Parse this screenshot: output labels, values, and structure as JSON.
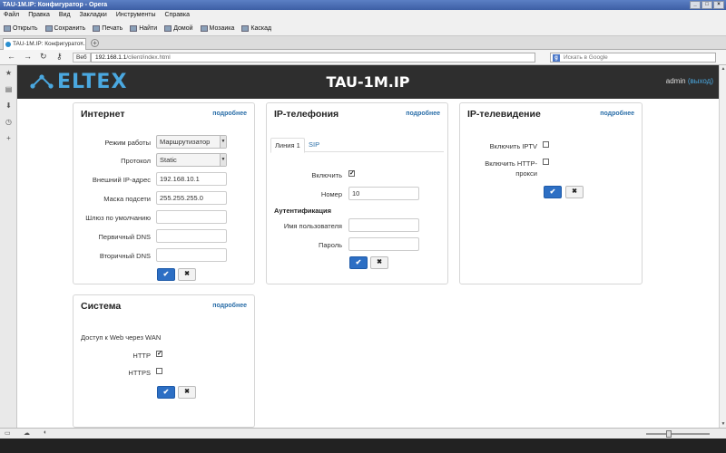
{
  "window": {
    "title": "TAU-1M.IP: Конфигуратор - Opera",
    "menu": [
      "Файл",
      "Правка",
      "Вид",
      "Закладки",
      "Инструменты",
      "Справка"
    ],
    "toolbar": [
      "Открыть",
      "Сохранить",
      "Печать",
      "Найти",
      "Домой",
      "Мозаика",
      "Каскад"
    ],
    "tab_title": "TAU-1M.IP: Конфигурато...",
    "web_badge": "Веб",
    "url_host": "192.168.1.1",
    "url_path": "/client/index.html",
    "search_placeholder": "Искать в Google"
  },
  "app": {
    "logo": "ELTEX",
    "title": "TAU-1M.IP",
    "user": "admin",
    "logout": "(выход)"
  },
  "more_label": "подробнее",
  "internet": {
    "title": "Интернет",
    "mode_label": "Режим работы",
    "mode_value": "Маршрутизатор",
    "protocol_label": "Протокол",
    "protocol_value": "Static",
    "ext_ip_label": "Внешний IP-адрес",
    "ext_ip_value": "192.168.10.1",
    "mask_label": "Маска подсети",
    "mask_value": "255.255.255.0",
    "gateway_label": "Шлюз по умолчанию",
    "gateway_value": "",
    "dns1_label": "Первичный DNS",
    "dns1_value": "",
    "dns2_label": "Вторичный DNS",
    "dns2_value": ""
  },
  "iptel": {
    "title": "IP-телефония",
    "tabs": [
      "Линия 1",
      "SIP"
    ],
    "enable_label": "Включить",
    "enable_checked": true,
    "number_label": "Номер",
    "number_value": "10",
    "auth_heading": "Аутентификация",
    "username_label": "Имя пользователя",
    "username_value": "",
    "password_label": "Пароль",
    "password_value": ""
  },
  "iptv": {
    "title": "IP-телевидение",
    "enable_iptv_label": "Включить IPTV",
    "enable_iptv_checked": false,
    "http_proxy_label_1": "Включить HTTP-",
    "http_proxy_label_2": "прокси",
    "http_proxy_checked": false
  },
  "system": {
    "title": "Система",
    "web_access_label": "Доступ к Web через WAN",
    "http_label": "HTTP",
    "http_checked": true,
    "https_label": "HTTPS",
    "https_checked": false
  },
  "icons": {
    "apply": "checkmark-icon",
    "cancel": "close-icon"
  },
  "colors": {
    "header_bg": "#2e2e2e",
    "brand_blue": "#4aa8e0",
    "link_blue": "#2a6ea8",
    "apply_blue": "#2d6fc4"
  }
}
